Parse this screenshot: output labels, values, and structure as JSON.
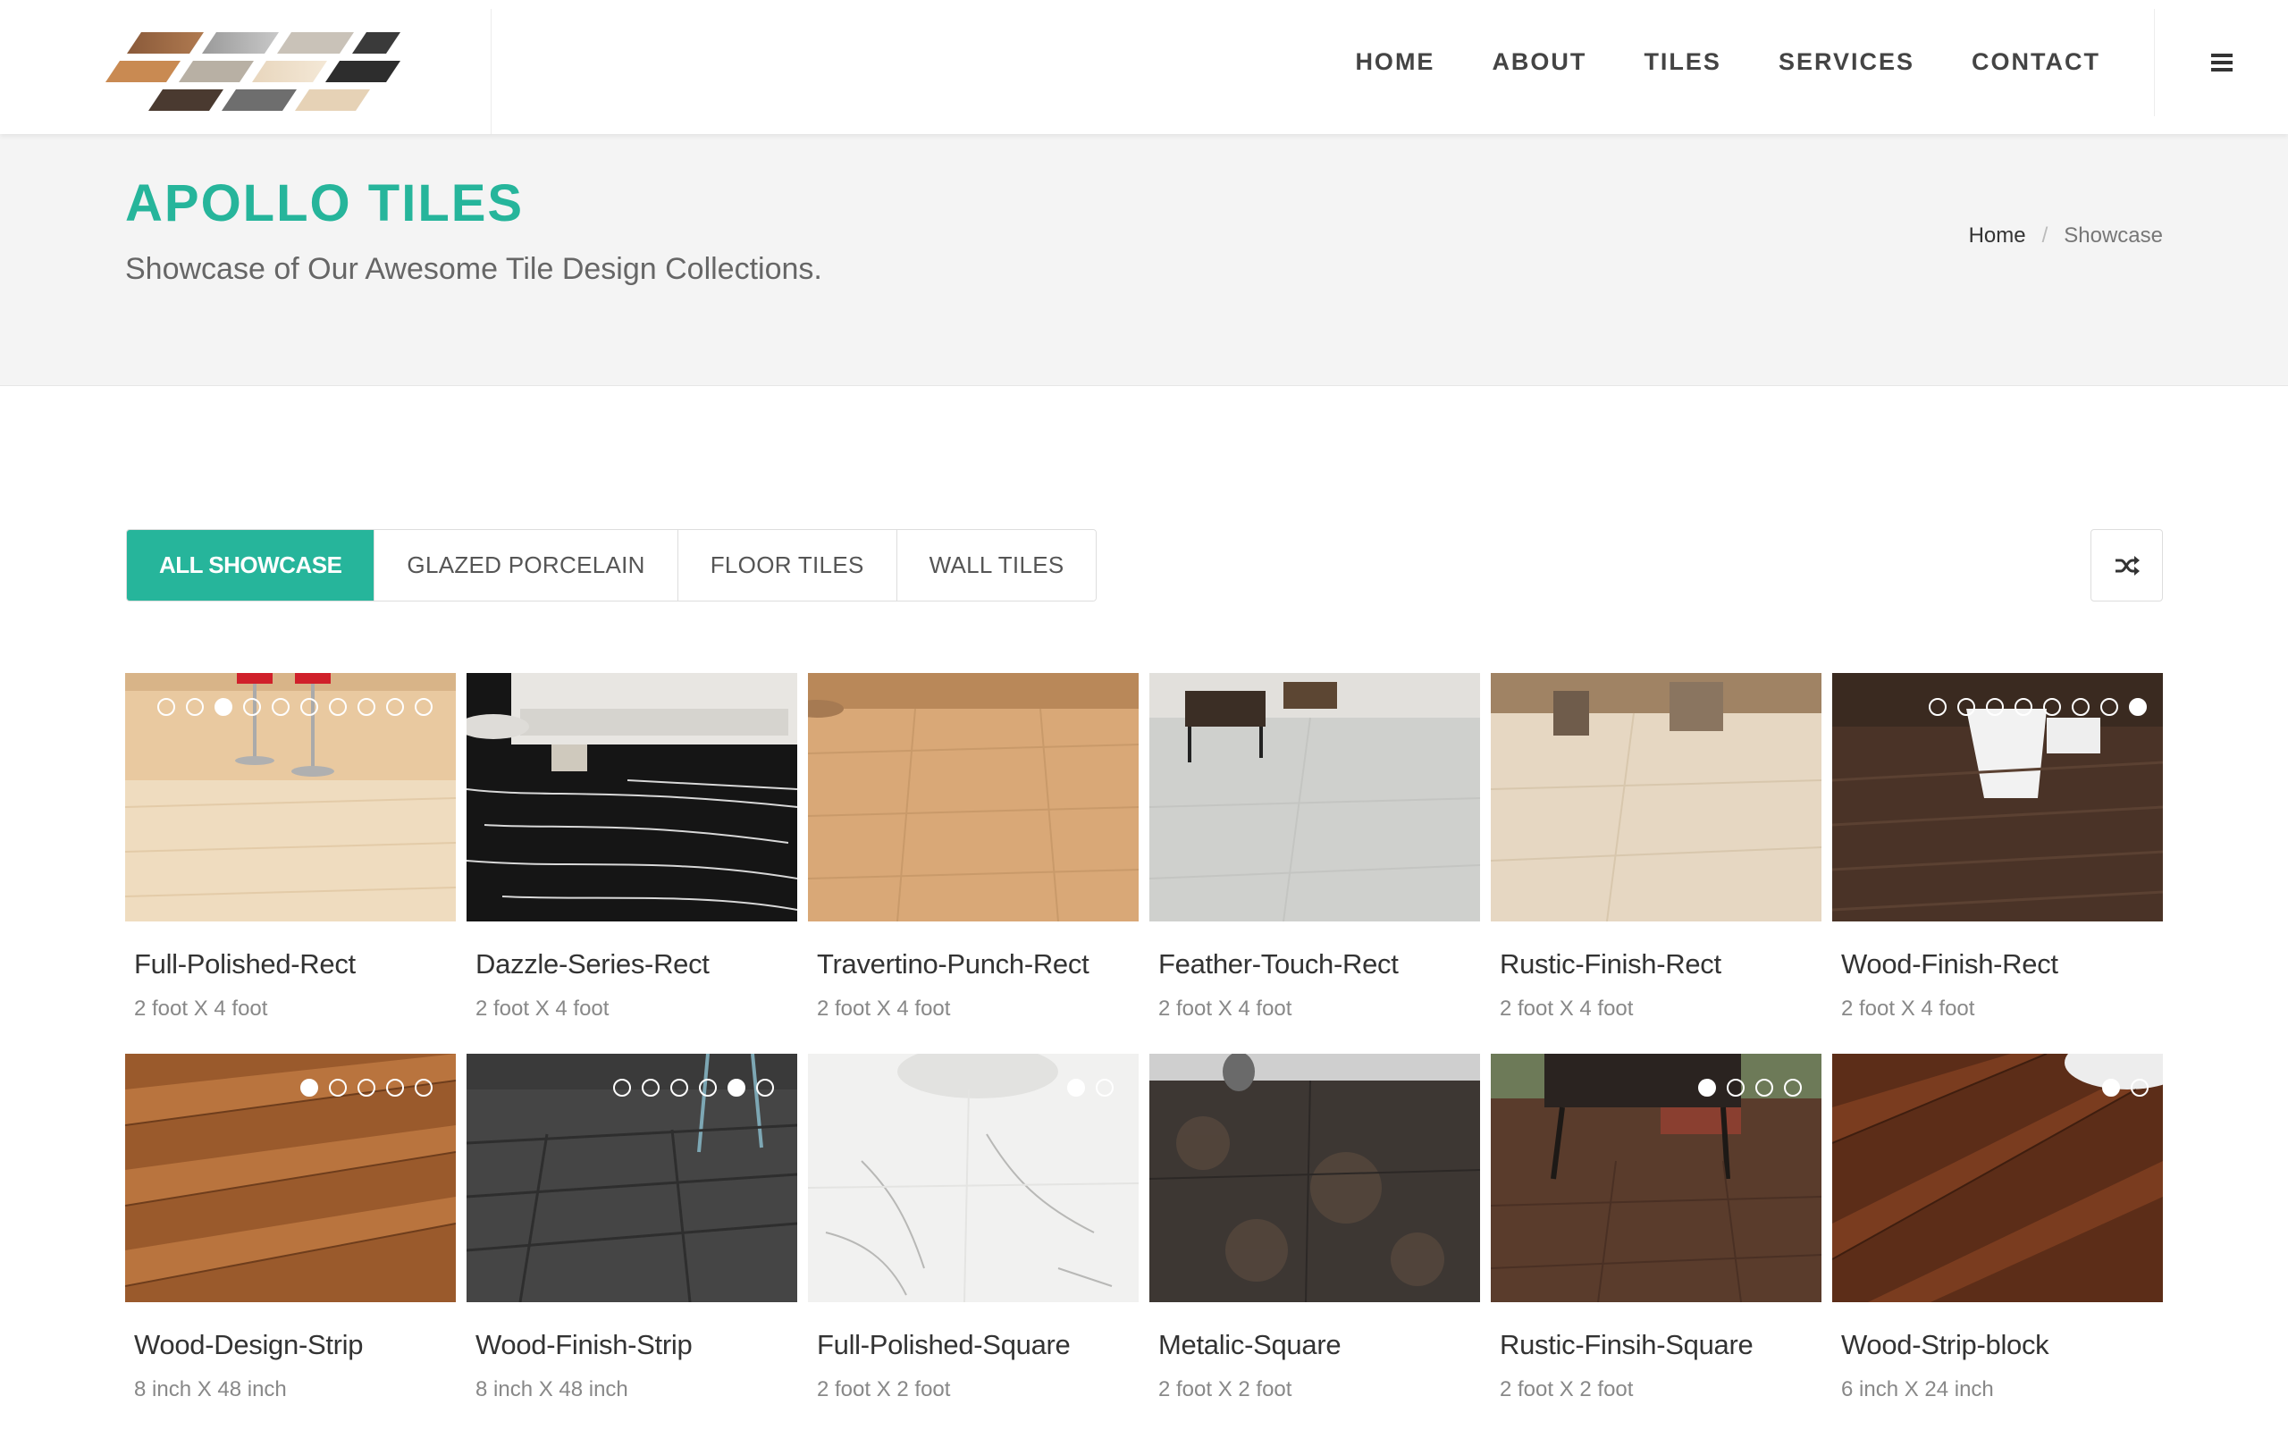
{
  "header": {
    "nav": [
      "HOME",
      "ABOUT",
      "TILES",
      "SERVICES",
      "CONTACT"
    ]
  },
  "page_title": {
    "title": "APOLLO TILES",
    "subtitle": "Showcase of Our Awesome Tile Design Collections.",
    "breadcrumb": {
      "home": "Home",
      "separator": "/",
      "current": "Showcase"
    }
  },
  "filters": [
    "ALL SHOWCASE",
    "GLAZED PORCELAIN",
    "FLOOR TILES",
    "WALL TILES"
  ],
  "colors": {
    "accent": "#26b59b"
  },
  "products": [
    {
      "name": "Full-Polished-Rect",
      "size": "2 foot X 4 foot",
      "slides": 10,
      "active_slide": 3
    },
    {
      "name": "Dazzle-Series-Rect",
      "size": "2 foot X 4 foot"
    },
    {
      "name": "Travertino-Punch-Rect",
      "size": "2 foot X 4 foot"
    },
    {
      "name": "Feather-Touch-Rect",
      "size": "2 foot X 4 foot"
    },
    {
      "name": "Rustic-Finish-Rect",
      "size": "2 foot X 4 foot"
    },
    {
      "name": "Wood-Finish-Rect",
      "size": "2 foot X 4 foot",
      "slides": 8,
      "active_slide": 8
    },
    {
      "name": "Wood-Design-Strip",
      "size": "8 inch X 48 inch",
      "slides": 5,
      "active_slide": 1
    },
    {
      "name": "Wood-Finish-Strip",
      "size": "8 inch X 48 inch",
      "slides": 6,
      "active_slide": 5
    },
    {
      "name": "Full-Polished-Square",
      "size": "2 foot X 2 foot",
      "slides": 2,
      "active_slide": 1
    },
    {
      "name": "Metalic-Square",
      "size": "2 foot X 2 foot"
    },
    {
      "name": "Rustic-Finsih-Square",
      "size": "2 foot X 2 foot",
      "slides": 4,
      "active_slide": 1
    },
    {
      "name": "Wood-Strip-block",
      "size": "6 inch X 24 inch",
      "slides": 2,
      "active_slide": 1
    }
  ]
}
